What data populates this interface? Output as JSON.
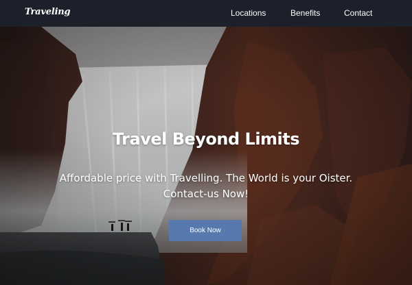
{
  "nav": {
    "brand": "Traveling",
    "links": [
      "Locations",
      "Benefits",
      "Contact"
    ]
  },
  "hero": {
    "title": "Travel Beyond Limits",
    "subtitle": "Affordable price with Travelling. The World is your Oister. Contact-us Now!",
    "cta_label": "Book Now",
    "background": "waterfall-cliffs-photo"
  },
  "colors": {
    "navbar_bg": "#1c202a",
    "cta_bg": "#5879ad",
    "text": "#ffffff"
  }
}
